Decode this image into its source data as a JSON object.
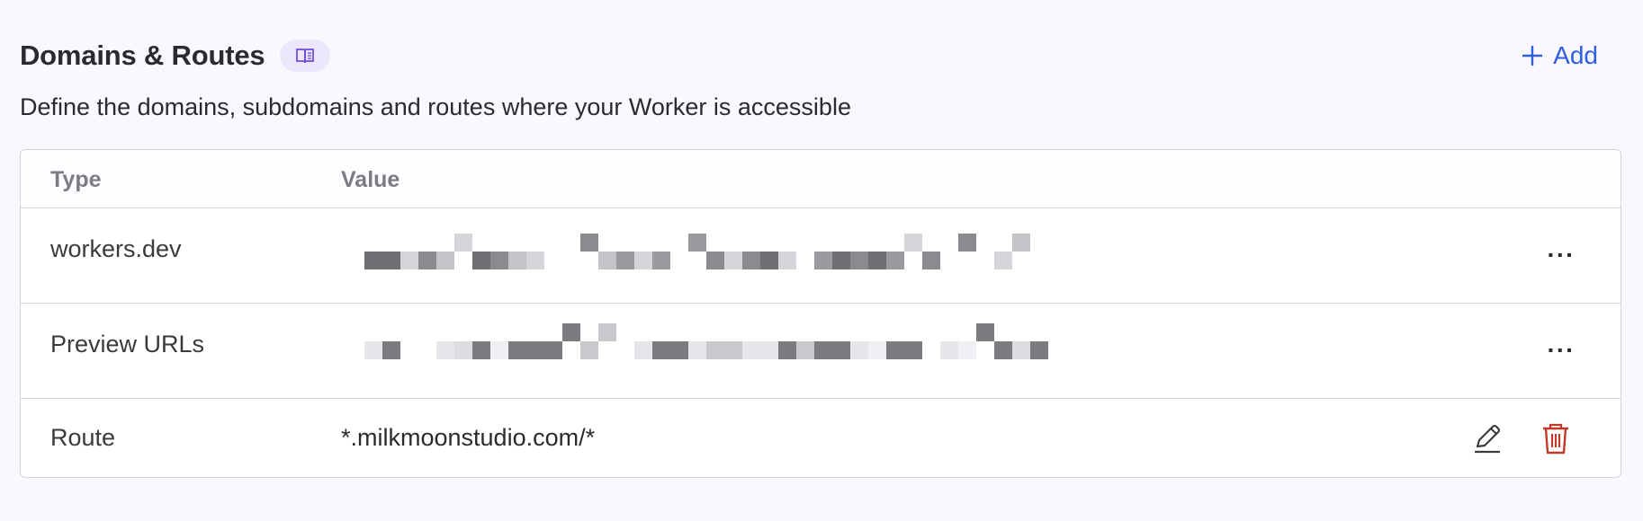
{
  "section": {
    "title": "Domains & Routes",
    "docs_icon": "book-open-icon",
    "add_label": "Add",
    "add_icon": "plus-icon",
    "description": "Define the domains, subdomains and routes where your Worker is accessible"
  },
  "table": {
    "columns": [
      "Type",
      "Value"
    ],
    "rows": [
      {
        "type": "workers.dev",
        "value": "",
        "value_redacted": true,
        "action": "more-icon"
      },
      {
        "type": "Preview URLs",
        "value": "",
        "value_redacted": true,
        "action": "more-icon"
      },
      {
        "type": "Route",
        "value": "*.milkmoonstudio.com/*",
        "value_redacted": false,
        "actions": [
          "pencil-icon",
          "trash-icon"
        ]
      }
    ]
  },
  "colors": {
    "accent": "#2f5ee0",
    "badge_bg": "#ece7fb",
    "badge_icon": "#6b4fd8",
    "danger": "#c0392b",
    "border": "#d4d3d8",
    "muted_text": "#7b7b82"
  },
  "menu_glyph": "···"
}
